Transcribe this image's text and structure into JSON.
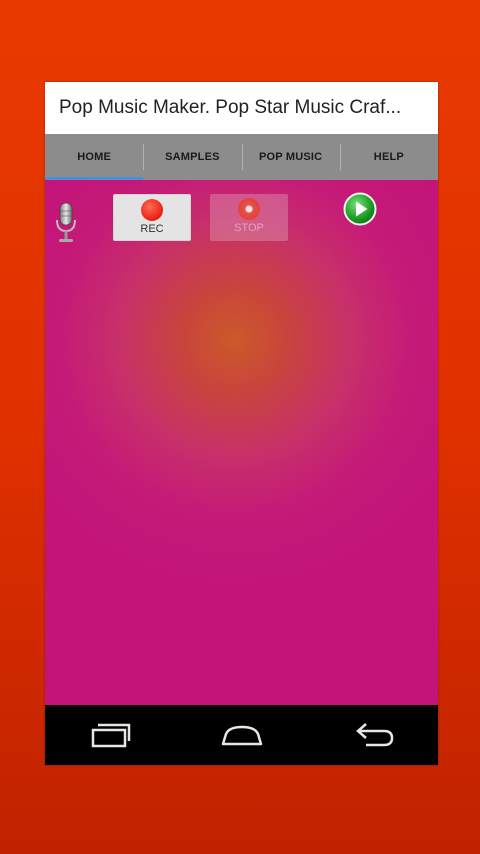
{
  "app": {
    "title": "Pop Music Maker. Pop Star Music Craf..."
  },
  "tabs": [
    {
      "label": "HOME",
      "active": true
    },
    {
      "label": "SAMPLES",
      "active": false
    },
    {
      "label": "POP MUSIC",
      "active": false
    },
    {
      "label": "HELP",
      "active": false
    }
  ],
  "controls": {
    "rec_label": "REC",
    "stop_label": "STOP",
    "icons": [
      "microphone-icon",
      "record-icon",
      "stop-icon",
      "play-icon"
    ]
  },
  "navbar": {
    "icons": [
      "recent-apps-icon",
      "home-icon",
      "back-icon"
    ]
  },
  "colors": {
    "background": "#e03000",
    "content": "#c51a78",
    "tab_bar": "#8c8c8c",
    "tab_indicator": "#4b8fd8",
    "record": "#e82010",
    "play": "#22a32a"
  }
}
